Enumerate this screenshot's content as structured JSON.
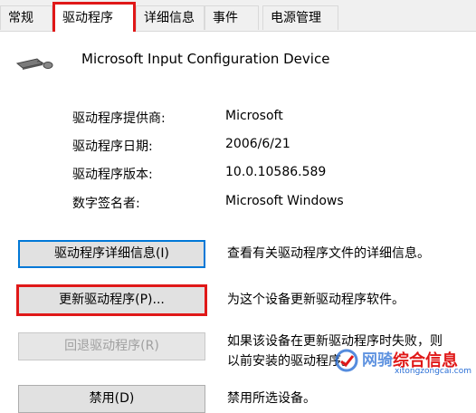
{
  "tabs": [
    {
      "label": "常规"
    },
    {
      "label": "驱动程序"
    },
    {
      "label": "详细信息"
    },
    {
      "label": "事件"
    },
    {
      "label": "电源管理"
    }
  ],
  "device": {
    "name": "Microsoft Input Configuration Device",
    "icon": "keyboard-mouse-icon"
  },
  "info": [
    {
      "label": "驱动程序提供商:",
      "value": "Microsoft"
    },
    {
      "label": "驱动程序日期:",
      "value": "2006/6/21"
    },
    {
      "label": "驱动程序版本:",
      "value": "10.0.10586.589"
    },
    {
      "label": "数字签名者:",
      "value": "Microsoft Windows"
    }
  ],
  "actions": [
    {
      "button": "驱动程序详细信息(I)",
      "desc": [
        "查看有关驱动程序文件的详细信息。"
      ]
    },
    {
      "button": "更新驱动程序(P)...",
      "desc": [
        "为这个设备更新驱动程序软件。"
      ]
    },
    {
      "button": "回退驱动程序(R)",
      "desc": [
        "如果该设备在更新驱动程序时失败，则",
        "以前安装的驱动程序。"
      ]
    },
    {
      "button": "禁用(D)",
      "desc": [
        "禁用所选设备。"
      ]
    }
  ],
  "watermark": {
    "site": "网骑",
    "name": "综合信息",
    "url": "xitongzongcai.com"
  },
  "colors": {
    "highlight": "#e01818",
    "focus": "#0078d7"
  }
}
